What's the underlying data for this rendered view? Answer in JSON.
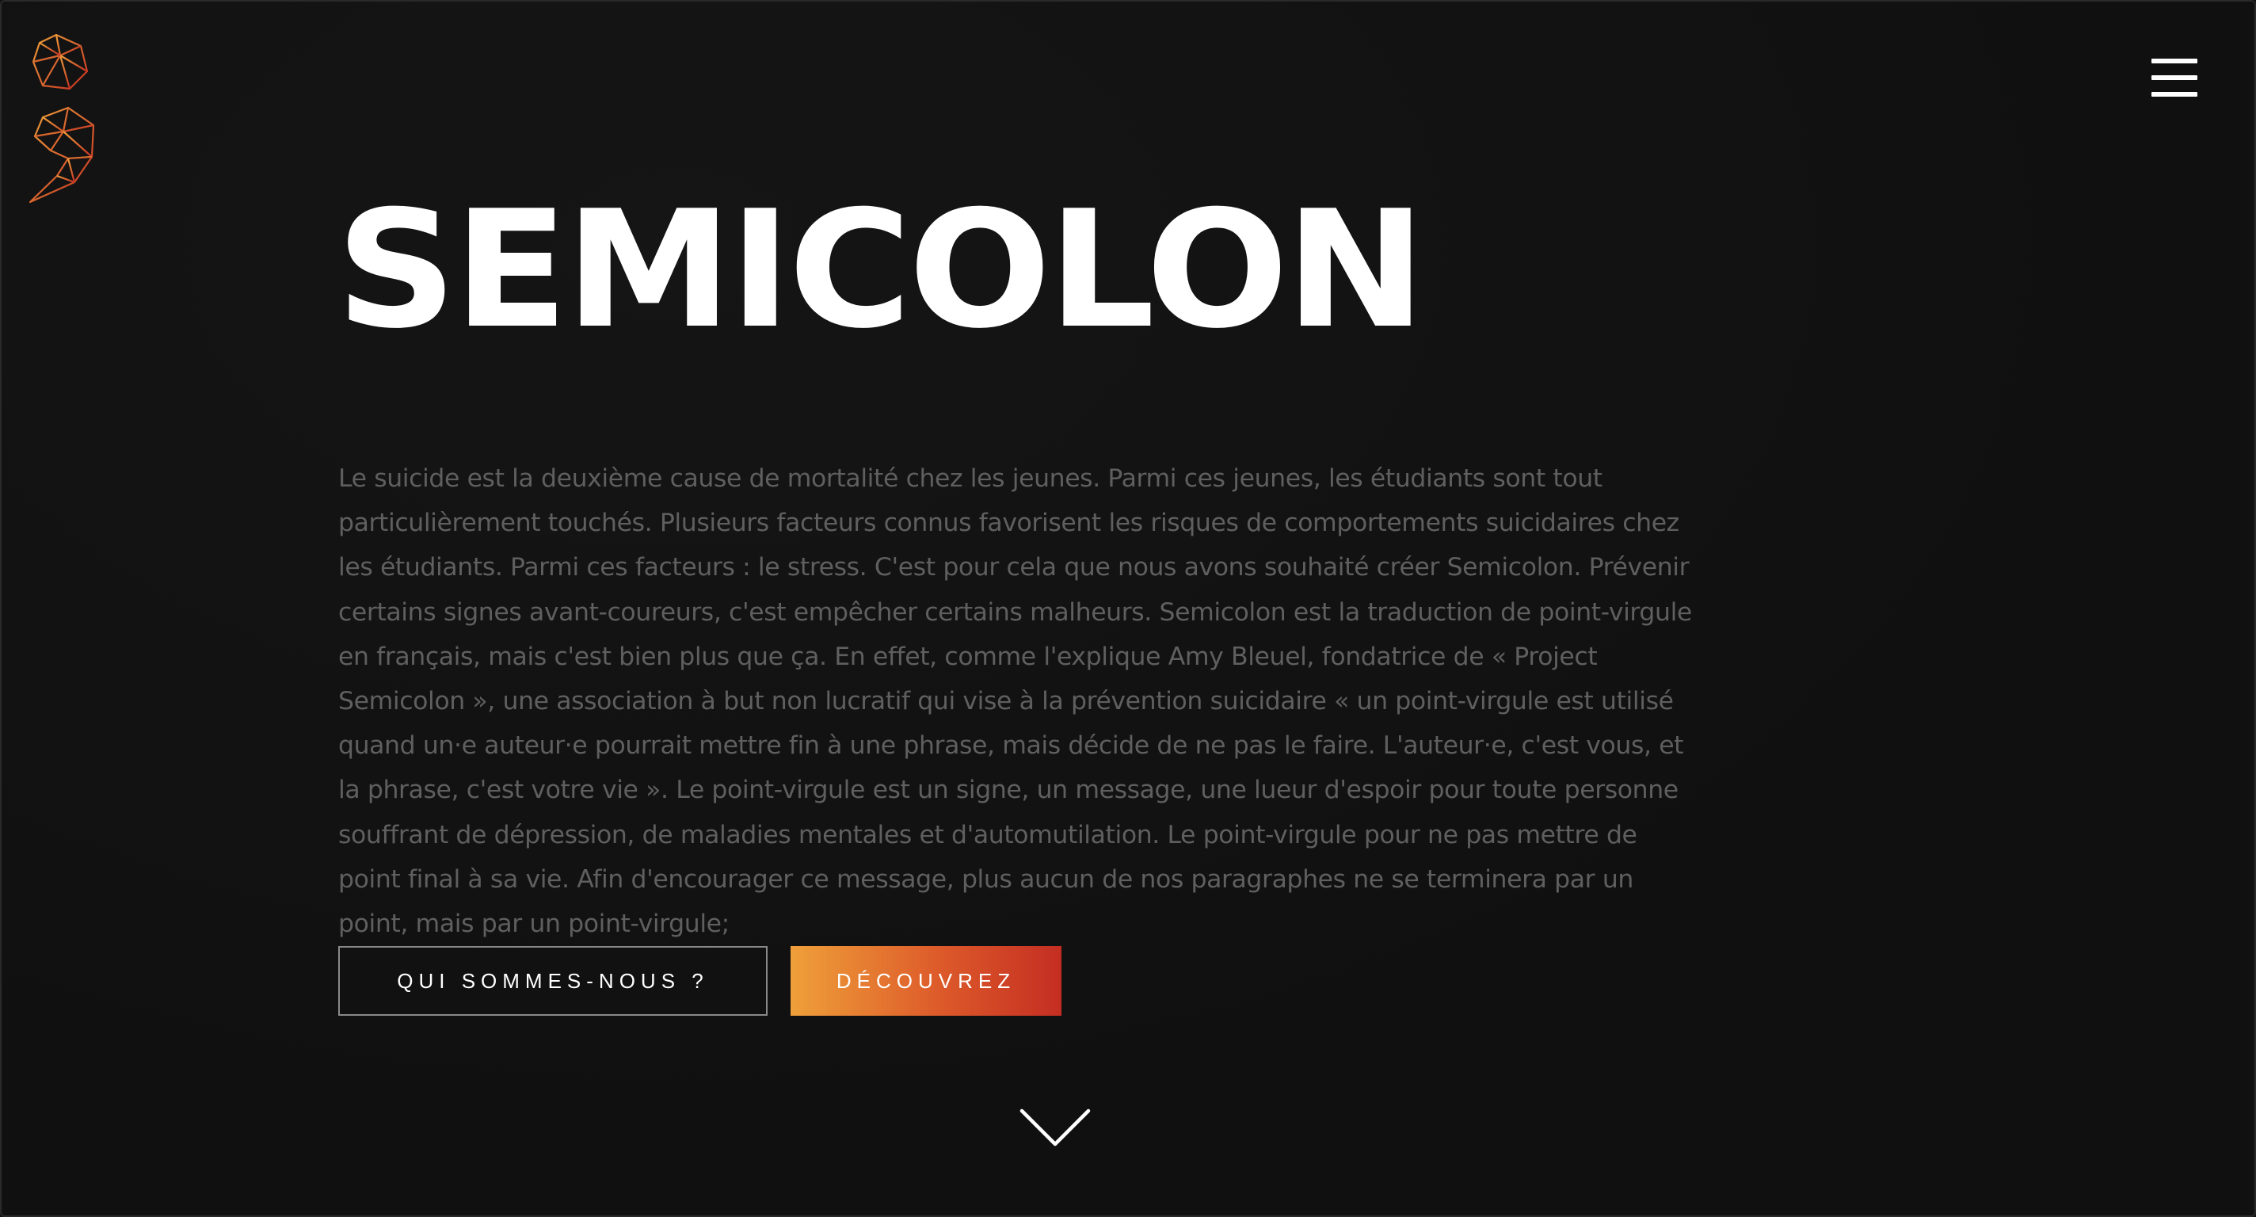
{
  "header": {
    "logo_icon": "semicolon-polygon-logo-icon",
    "menu_icon": "hamburger-menu-icon"
  },
  "hero": {
    "title": "SEMICOLON",
    "intro": "Le suicide est la deuxième cause de mortalité chez les jeunes. Parmi ces jeunes, les étudiants sont tout particulièrement touchés. Plusieurs facteurs connus favorisent les risques de comportements suicidaires chez les étudiants. Parmi ces facteurs : le stress. C'est pour cela que nous avons souhaité créer Semicolon. Prévenir certains signes avant-coureurs, c'est empêcher certains malheurs. Semicolon est la traduction de point-virgule en français, mais c'est bien plus que ça. En effet, comme l'explique Amy Bleuel, fondatrice de « Project Semicolon », une association à but non lucratif qui vise à la prévention suicidaire « un point-virgule est utilisé quand un·e auteur·e pourrait mettre fin à une phrase, mais décide de ne pas le faire. L'auteur·e, c'est vous, et la phrase, c'est votre vie ». Le point-virgule est un signe, un message, une lueur d'espoir pour toute personne souffrant de dépression, de maladies mentales et d'automutilation. Le point-virgule pour ne pas mettre de point final à sa vie. Afin d'encourager ce message, plus aucun de nos paragraphes ne se terminera par un point, mais par un point-virgule;",
    "buttons": {
      "who_label": "QUI SOMMES-NOUS ?",
      "discover_label": "DÉCOUVREZ"
    },
    "scroll_icon": "chevron-down-icon"
  },
  "colors": {
    "background": "#111111",
    "text_muted": "#5f5f5f",
    "accent_start": "#efa03a",
    "accent_end": "#c42e22"
  }
}
